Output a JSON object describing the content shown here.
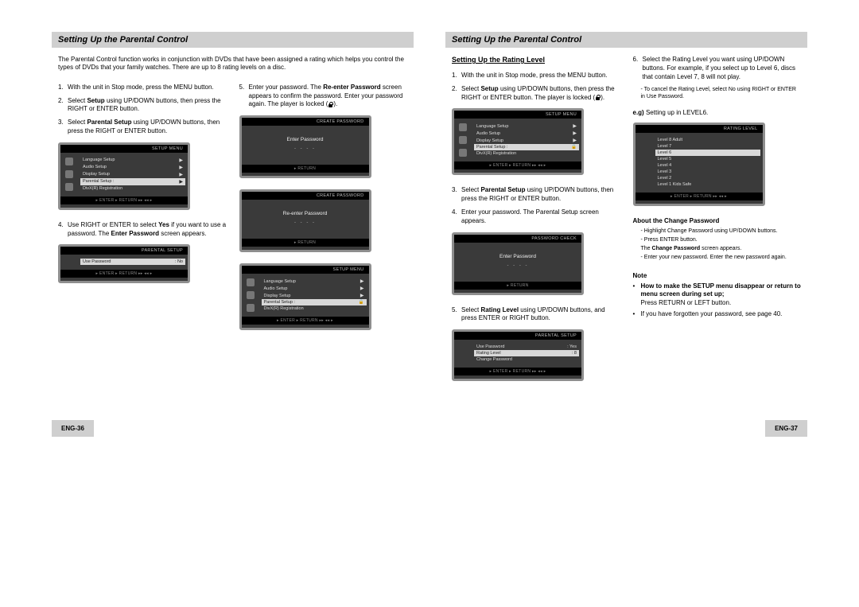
{
  "left": {
    "title": "Setting Up the Parental Control",
    "intro": "The Parental Control function works in conjunction with DVDs that have been assigned a rating which helps you control the types of DVDs that your family watches. There are up to 8 rating levels on a disc.",
    "colA": {
      "s1": "With the unit in Stop mode, press the MENU button.",
      "s2b": "Setup",
      "s2a": "using UP/DOWN buttons, then press the RIGHT or ENTER button.",
      "s3b": "Parental Setup",
      "s3a": "using UP/DOWN buttons, then press the RIGHT or ENTER button.",
      "s4b": "Yes",
      "s4c": "Enter Password"
    },
    "colB": {
      "s5b": "Re-enter Password",
      "s5a": "screen appears to confirm the password. Enter your password again. The player is locked"
    },
    "pagenum": "ENG-36"
  },
  "right": {
    "title": "Setting Up the Parental Control",
    "subhead": "Setting Up the Rating Level",
    "colA": {
      "s1": "With the unit in Stop mode, press the MENU button.",
      "s2b": "Setup",
      "s2a": "using UP/DOWN buttons, then press the RIGHT or ENTER button. The player is locked",
      "s3b": "Parental Setup",
      "s3a": "using UP/DOWN buttons, then press the RIGHT or ENTER button.",
      "s4": "Enter your password. The Parental Setup screen appears.",
      "s5b": "Rating Level",
      "s5a": "using UP/DOWN buttons, and press ENTER or RIGHT button."
    },
    "colB": {
      "s6": "Select the Rating Level you want using UP/DOWN buttons. For example, if you select up to Level 6, discs that contain Level 7, 8 will not play.",
      "cancel": "- To cancel the Rating Level, select No using RIGHT or ENTER in Use Password.",
      "eg_label": "e.g)",
      "eg_text": "Setting up in LEVEL6.",
      "about": "About the Change Password",
      "c1": "- Highlight Change Password using UP/DOWN buttons.",
      "c2": "- Press ENTER button.",
      "c3b": "Change Password",
      "c3a": "screen appears.",
      "c4": "- Enter your new password. Enter the new password again.",
      "note": "Note",
      "n1b": "How to make the SETUP menu disappear or return to menu screen during set up;",
      "n1a": "Press RETURN or LEFT button.",
      "n2": "If you have forgotten your password, see page 40."
    },
    "pagenum": "ENG-37"
  },
  "osd": {
    "setup_title": "SETUP MENU",
    "parental_title": "PARENTAL SETUP",
    "create_title": "CREATE PASSWORD",
    "passcheck_title": "PASSWORD CHECK",
    "rating_title": "RATING LEVEL",
    "menu": [
      "Language Setup",
      "Audio Setup",
      "Display Setup",
      "Parental Setup :",
      "DivX(R) Registration"
    ],
    "usepass": "Use Password",
    "no": ": No",
    "yes": ": Yes",
    "rating_level": "Rating Level",
    "level8": ": 8",
    "change_pass": "Change Password",
    "enter_pass": "Enter Password",
    "reenter_pass": "Re-enter Password",
    "dashes": "- - - -",
    "levels": [
      "Level 8 Adult",
      "Level 7",
      "Level 6",
      "Level 5",
      "Level 4",
      "Level 3",
      "Level 2",
      "Level 1 Kids Safe"
    ],
    "footer": "▸ ENTER   ▸ RETURN   ▸▸ ◂◂  ▸",
    "footer2": "▸ RETURN"
  }
}
